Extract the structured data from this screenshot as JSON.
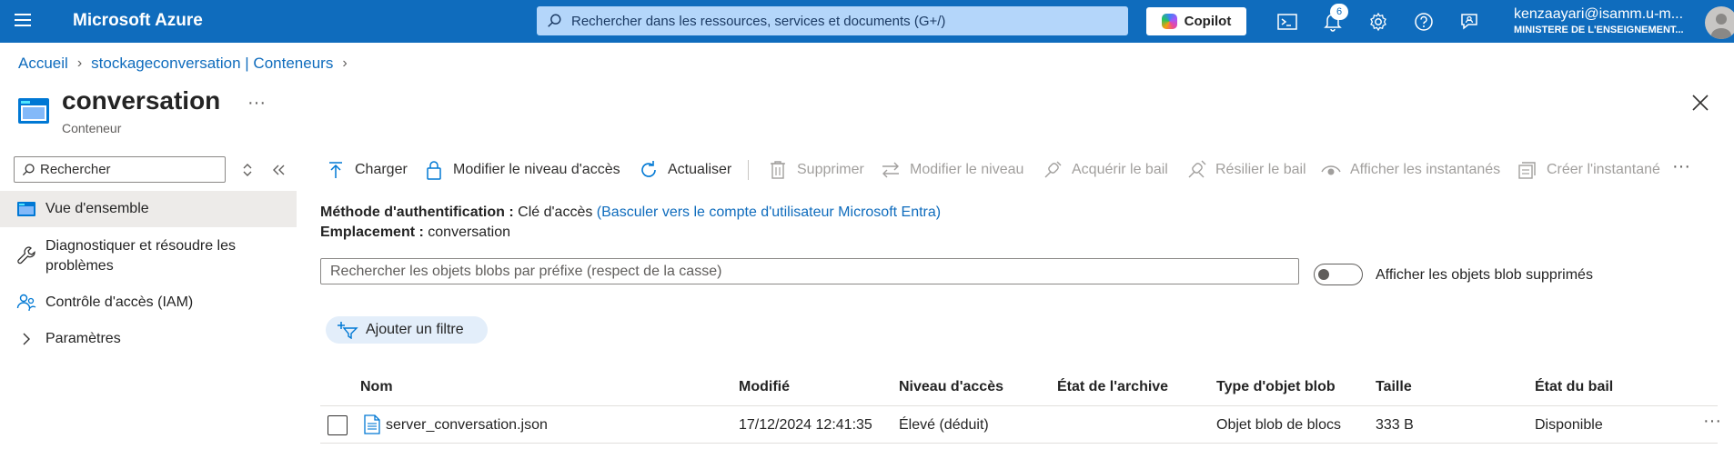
{
  "topbar": {
    "brand": "Microsoft Azure",
    "search_placeholder": "Rechercher dans les ressources, services et documents (G+/)",
    "copilot_label": "Copilot",
    "notification_count": "6",
    "account_user": "kenzaayari@isamm.u-m...",
    "account_org": "MINISTERE DE L'ENSEIGNEMENT..."
  },
  "breadcrumb": {
    "items": [
      "Accueil",
      "stockageconversation | Conteneurs"
    ]
  },
  "resource": {
    "title": "conversation",
    "subtitle": "Conteneur",
    "more": "···"
  },
  "nav": {
    "search_placeholder": "Rechercher",
    "items": [
      {
        "label": "Vue d'ensemble",
        "icon": "container-icon"
      },
      {
        "label": "Diagnostiquer et résoudre les problèmes",
        "icon": "wrench-icon"
      },
      {
        "label": "Contrôle d'accès (IAM)",
        "icon": "people-icon"
      },
      {
        "label": "Paramètres",
        "icon": "chevron-right-icon"
      }
    ]
  },
  "toolbar": {
    "upload": "Charger",
    "change_access": "Modifier le niveau d'accès",
    "refresh": "Actualiser",
    "delete": "Supprimer",
    "change_tier": "Modifier le niveau",
    "acquire_lease": "Acquérir le bail",
    "break_lease": "Résilier le bail",
    "view_snapshots": "Afficher les instantanés",
    "create_snapshot": "Créer l'instantané",
    "more": "···"
  },
  "info": {
    "auth_label": "Méthode d'authentification :",
    "auth_value": "Clé d'accès",
    "auth_link": "(Basculer vers le compte d'utilisateur Microsoft Entra)",
    "location_label": "Emplacement :",
    "location_value": "conversation"
  },
  "blob_search_placeholder": "Rechercher les objets blobs par préfixe (respect de la casse)",
  "show_deleted_label": "Afficher les objets blob supprimés",
  "add_filter_label": "Ajouter un filtre",
  "table": {
    "headers": [
      "Nom",
      "Modifié",
      "Niveau d'accès",
      "État de l'archive",
      "Type d'objet blob",
      "Taille",
      "État du bail"
    ],
    "rows": [
      {
        "name": "server_conversation.json",
        "modified": "17/12/2024 12:41:35",
        "access_tier": "Élevé (déduit)",
        "archive_status": "",
        "blob_type": "Objet blob de blocs",
        "size": "333 B",
        "lease_state": "Disponible",
        "more": "···"
      }
    ]
  },
  "colors": {
    "topbar": "#0f6cbd",
    "link": "#0f6cbd",
    "active_nav": "#edebe9",
    "disabled_text": "#a19f9d"
  }
}
